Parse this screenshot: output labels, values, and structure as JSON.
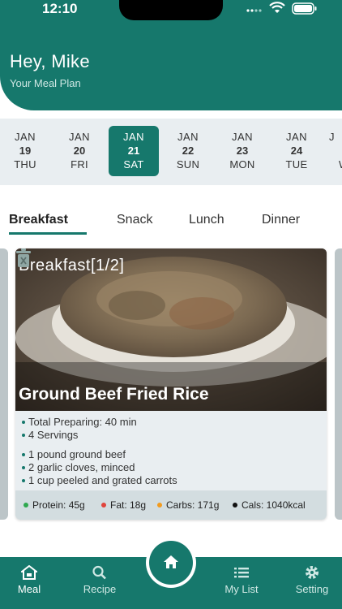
{
  "status": {
    "time": "12:10"
  },
  "header": {
    "greeting": "Hey, Mike",
    "subtitle": "Your Meal Plan"
  },
  "dates": [
    {
      "month": "JAN",
      "day": "19",
      "weekday": "THU",
      "selected": false
    },
    {
      "month": "JAN",
      "day": "20",
      "weekday": "FRI",
      "selected": false
    },
    {
      "month": "JAN",
      "day": "21",
      "weekday": "SAT",
      "selected": true
    },
    {
      "month": "JAN",
      "day": "22",
      "weekday": "SUN",
      "selected": false
    },
    {
      "month": "JAN",
      "day": "23",
      "weekday": "MON",
      "selected": false
    },
    {
      "month": "JAN",
      "day": "24",
      "weekday": "TUE",
      "selected": false
    },
    {
      "month": "J",
      "day": "",
      "weekday": "W",
      "selected": false
    }
  ],
  "tabs": [
    "Breakfast",
    "Snack",
    "Lunch",
    "Dinner"
  ],
  "card": {
    "label": "Breakfast[1/2]",
    "dish": "Ground Beef Fried Rice",
    "prep": "Total Preparing: 40 min",
    "servings": "4 Servings",
    "ingredients": [
      "1 pound ground beef",
      "2 garlic cloves, minced",
      "1 cup peeled and grated carrots"
    ],
    "macros": {
      "protein": "Protein: 45g",
      "fat": "Fat: 18g",
      "carbs": "Carbs: 171g",
      "cals": "Cals: 1040kcal"
    }
  },
  "nav": {
    "meal": "Meal",
    "recipe": "Recipe",
    "mylist": "My List",
    "setting": "Setting"
  },
  "colors": {
    "primary": "#16786c",
    "protein": "#2fa84f",
    "fat": "#e0443c",
    "carbs": "#f29b1e",
    "cals": "#111111"
  },
  "icons": [
    "home-icon",
    "search-icon",
    "list-icon",
    "gear-icon",
    "trash-icon",
    "wifi-icon",
    "battery-icon",
    "signal-icon"
  ]
}
